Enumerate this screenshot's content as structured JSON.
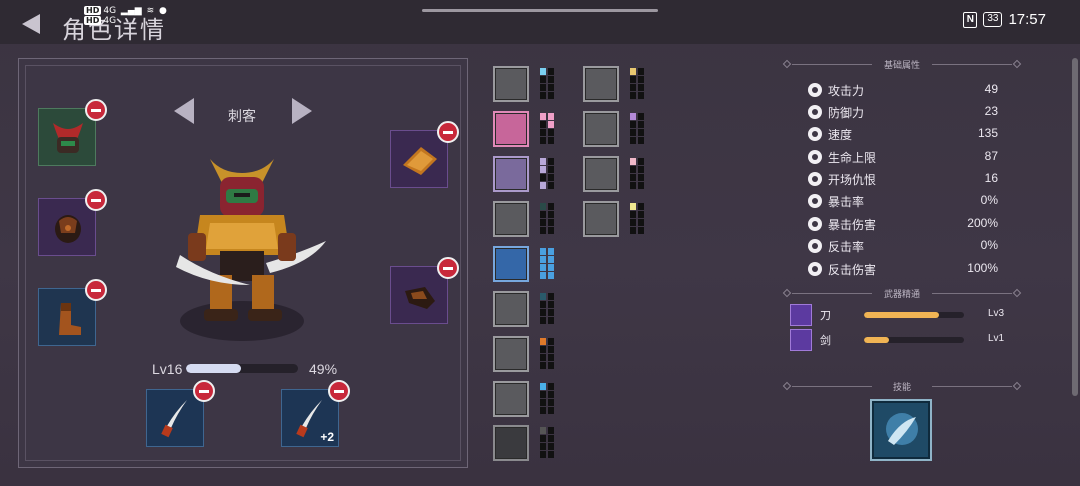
{
  "status_bar": {
    "left_badges": [
      "HD",
      "4G",
      "HD",
      "4G"
    ],
    "time": "17:57",
    "battery": "33"
  },
  "header": {
    "title": "角色详情"
  },
  "character": {
    "class_name": "刺客",
    "level_label": "Lv16",
    "xp_percent_text": "49%",
    "xp_fraction": 0.49,
    "weapon_bonus": "+2"
  },
  "stats": {
    "section_title": "基础属性",
    "rows": [
      {
        "label": "攻击力",
        "value": "49",
        "icon": "sword-icon"
      },
      {
        "label": "防御力",
        "value": "23",
        "icon": "shield-icon"
      },
      {
        "label": "速度",
        "value": "135",
        "icon": "boot-icon"
      },
      {
        "label": "生命上限",
        "value": "87",
        "icon": "heart-icon"
      },
      {
        "label": "开场仇恨",
        "value": "16",
        "icon": "skull-icon"
      },
      {
        "label": "暴击率",
        "value": "0%",
        "icon": "burst-icon"
      },
      {
        "label": "暴击伤害",
        "value": "200%",
        "icon": "crossed-swords-icon"
      },
      {
        "label": "反击率",
        "value": "0%",
        "icon": "counter-icon"
      },
      {
        "label": "反击伤害",
        "value": "100%",
        "icon": "counter-damage-icon"
      }
    ]
  },
  "mastery": {
    "section_title": "武器精通",
    "rows": [
      {
        "label": "刀",
        "level": "Lv3",
        "fraction": 0.75
      },
      {
        "label": "剑",
        "level": "Lv1",
        "fraction": 0.25
      }
    ]
  },
  "skills": {
    "section_title": "技能"
  },
  "colors": {
    "remove_badge": "#c8283a",
    "xp_fill": "#d6dcf2",
    "mastery_fill": "#f0b454"
  }
}
